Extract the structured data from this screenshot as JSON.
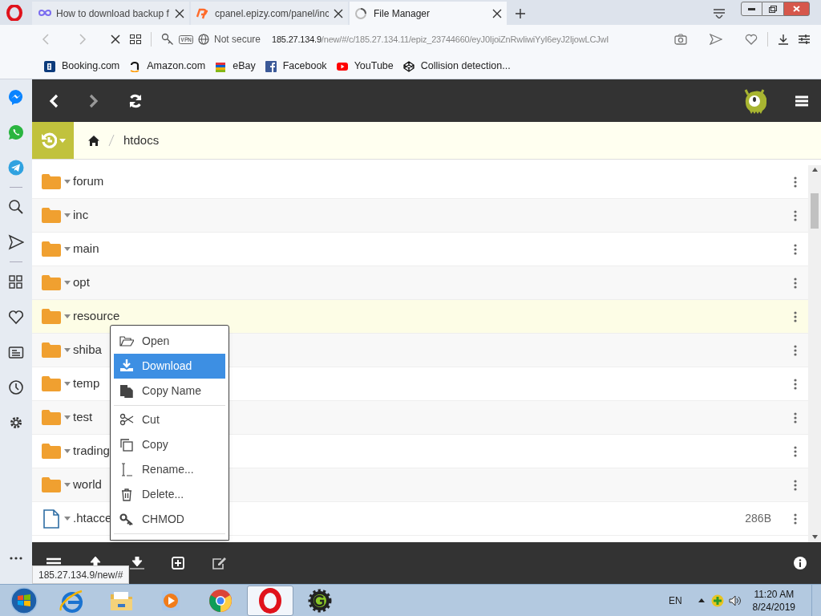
{
  "browser": {
    "tabs": [
      {
        "kind": "infinity",
        "title": "How to download backup f",
        "selected": false
      },
      {
        "kind": "cpanel",
        "title": "cpanel.epizy.com/panel/inc",
        "selected": false
      },
      {
        "kind": "loading",
        "title": "File Manager",
        "selected": true
      }
    ],
    "address": {
      "security": "Not secure",
      "host": "185.27.134.9",
      "path": "/new/#/c/185.27.134.11/epiz_23744660/eyJ0IjoiZnRwIiwiYyI6eyJ2IjowLCJwI"
    },
    "bookmarks": [
      {
        "kind": "booking",
        "label": "Booking.com"
      },
      {
        "kind": "amazon",
        "label": "Amazon.com"
      },
      {
        "kind": "ebay",
        "label": "eBay"
      },
      {
        "kind": "facebook",
        "label": "Facebook"
      },
      {
        "kind": "youtube",
        "label": "YouTube"
      },
      {
        "kind": "codepen",
        "label": "Collision detection..."
      }
    ],
    "status_url": "185.27.134.9/new/#"
  },
  "file_manager": {
    "breadcrumb": [
      "htdocs"
    ],
    "files": [
      {
        "kind": "folder",
        "name": "forum",
        "selected": false
      },
      {
        "kind": "folder",
        "name": "inc",
        "selected": false
      },
      {
        "kind": "folder",
        "name": "main",
        "selected": false
      },
      {
        "kind": "folder",
        "name": "opt",
        "selected": false
      },
      {
        "kind": "folder",
        "name": "resource",
        "selected": true
      },
      {
        "kind": "folder",
        "name": "shiba",
        "selected": false
      },
      {
        "kind": "folder",
        "name": "temp",
        "selected": false
      },
      {
        "kind": "folder",
        "name": "test",
        "selected": false
      },
      {
        "kind": "folder",
        "name": "trading",
        "selected": false
      },
      {
        "kind": "folder",
        "name": "world",
        "selected": false
      },
      {
        "kind": "file",
        "name": ".htacce",
        "size": "286B",
        "selected": false
      }
    ],
    "context_menu": [
      {
        "kind": "open",
        "label": "Open",
        "selected": false
      },
      {
        "kind": "download",
        "label": "Download",
        "selected": true
      },
      {
        "kind": "copyname",
        "label": "Copy Name",
        "selected": false
      },
      {
        "kind": "divider"
      },
      {
        "kind": "cut",
        "label": "Cut",
        "selected": false
      },
      {
        "kind": "copy",
        "label": "Copy",
        "selected": false
      },
      {
        "kind": "rename",
        "label": "Rename...",
        "selected": false
      },
      {
        "kind": "delete",
        "label": "Delete...",
        "selected": false
      },
      {
        "kind": "chmod",
        "label": "CHMOD",
        "selected": false
      },
      {
        "kind": "divider"
      }
    ]
  },
  "taskbar": {
    "apps": [
      {
        "kind": "ie",
        "selected": false
      },
      {
        "kind": "folder",
        "selected": false
      },
      {
        "kind": "media",
        "selected": false
      },
      {
        "kind": "chrome",
        "selected": false
      },
      {
        "kind": "opera",
        "selected": true
      },
      {
        "kind": "gear",
        "selected": false
      }
    ],
    "language": "EN",
    "time": "11:20 AM",
    "date": "8/24/2019"
  }
}
